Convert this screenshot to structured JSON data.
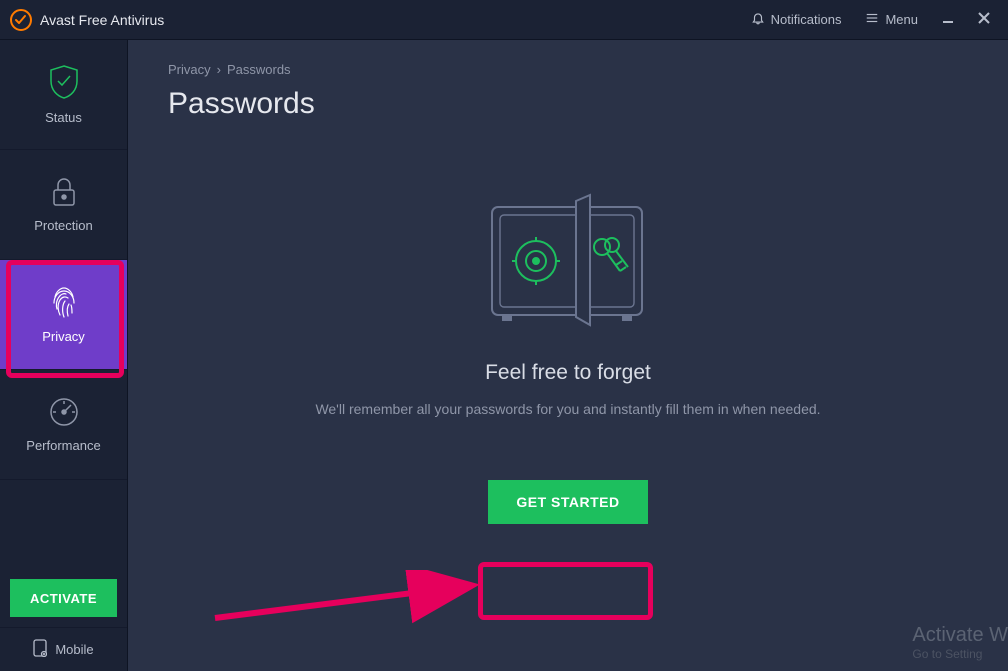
{
  "titlebar": {
    "app_title": "Avast Free Antivirus",
    "notifications_label": "Notifications",
    "menu_label": "Menu"
  },
  "sidebar": {
    "items": [
      {
        "label": "Status"
      },
      {
        "label": "Protection"
      },
      {
        "label": "Privacy"
      },
      {
        "label": "Performance"
      }
    ],
    "activate_label": "ACTIVATE",
    "mobile_label": "Mobile"
  },
  "breadcrumb": {
    "part1": "Privacy",
    "sep": "›",
    "part2": "Passwords"
  },
  "page": {
    "title": "Passwords"
  },
  "hero": {
    "title": "Feel free to forget",
    "subtitle": "We'll remember all your passwords for you and instantly fill them in when needed.",
    "get_started_label": "GET STARTED"
  },
  "watermark": {
    "line1": "Activate W",
    "line2": "Go to Setting"
  }
}
